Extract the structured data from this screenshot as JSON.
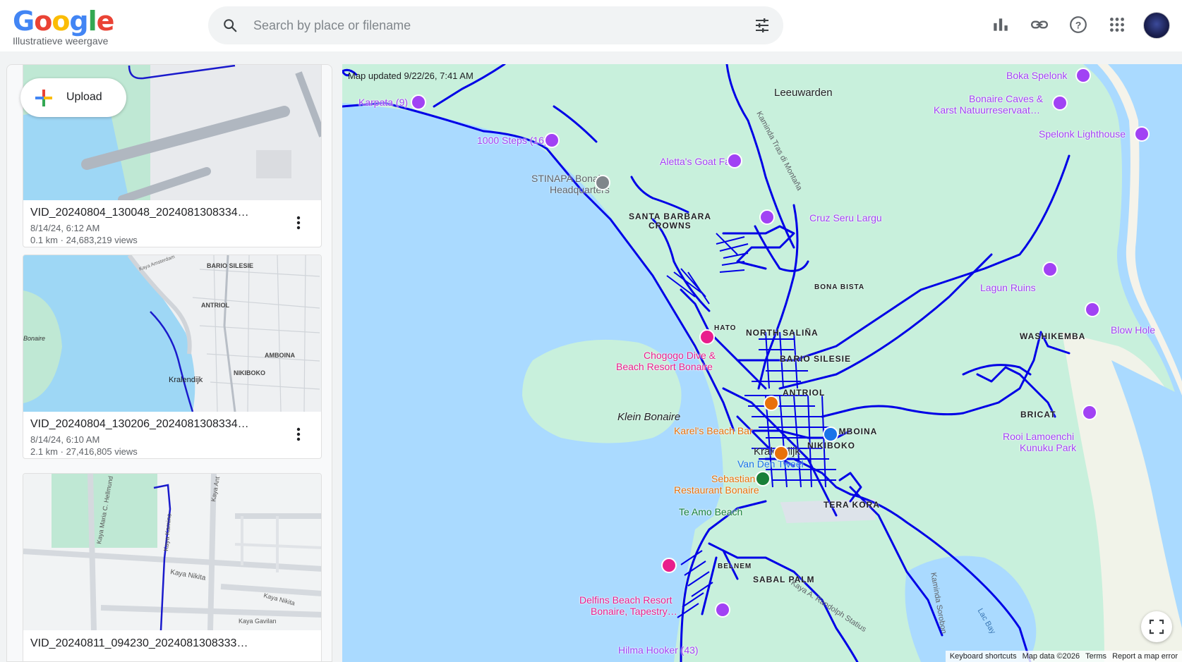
{
  "header": {
    "logo_letters": [
      "G",
      "o",
      "o",
      "g",
      "l",
      "e"
    ],
    "logo_colors": [
      "#4285F4",
      "#EA4335",
      "#FBBC05",
      "#4285F4",
      "#34A853",
      "#EA4335"
    ],
    "subtitle": "Illustratieve weergave",
    "search_placeholder": "Search by place or filename",
    "icons": [
      "bar-chart-icon",
      "link-icon",
      "help-icon",
      "apps-grid-icon"
    ]
  },
  "panel": {
    "upload_label": "Upload",
    "cards": [
      {
        "title": "VID_20240804_130048_2024081308334…",
        "date": "8/14/24, 6:12 AM",
        "stats": "0.1 km · 24,683,219 views"
      },
      {
        "title": "VID_20240804_130206_2024081308334…",
        "date": "8/14/24, 6:10 AM",
        "stats": "2.1 km · 27,416,805 views"
      },
      {
        "title": "VID_20240811_094230_2024081308333…",
        "date": "",
        "stats": ""
      }
    ],
    "thumb2_labels": {
      "bario": "BARIO SILESIE",
      "antriol": "ANTRIOL",
      "amboina": "AMBOINA",
      "nikiboko": "NIKIBOKO",
      "kralendijk": "Kralendijk",
      "bonaire": "Bonaire",
      "road1": "Kaya Amsterdam"
    },
    "thumb3_labels": {
      "r1": "Kaya Maria C. Hellmund",
      "r2": "Kaya Kamino",
      "r3": "Kaya Ant",
      "r4": "Kaya Nikita",
      "r5": "Kaya Nikita",
      "r6": "Kaya Gavilan"
    }
  },
  "map": {
    "updated": "Map updated 9/22/26, 7:41 AM",
    "labels": {
      "leeuwarden": "Leeuwarden",
      "boka_spelonk": "Boka Spelonk",
      "bonaire_caves_1": "Bonaire Caves &",
      "bonaire_caves_2": "Karst Natuurreservaat…",
      "spelonk_lighthouse": "Spelonk Lighthouse",
      "karpata": "Karpata (9)",
      "steps": "1000 Steps (16)",
      "aletta": "Aletta's Goat Farm",
      "stinapa_1": "STINAPA Bonaire",
      "stinapa_2": "Headquarters",
      "santa_barbara_1": "SANTA BARBARA",
      "santa_barbara_2": "CROWNS",
      "cruz": "Cruz Seru Largu",
      "bona_bista": "BONA BISTA",
      "lagun": "Lagun Ruins",
      "hato": "HATO",
      "north_salina": "NORTH SALIÑA",
      "washikemba": "WASHIKEMBA",
      "blow_hole": "Blow Hole",
      "chogogo_1": "Chogogo Dive &",
      "chogogo_2": "Beach Resort Bonaire",
      "bario_silesie": "BARIO SILESIE",
      "antriol": "ANTRIOL",
      "bricat": "BRICAT",
      "klein_bonaire": "Klein Bonaire",
      "karels": "Karel's Beach Bar",
      "amboina": "AMBOINA",
      "rooi_1": "Rooi Lamoenchi",
      "rooi_2": "Kunuku Park",
      "kralendijk": "Kralendijk",
      "nikiboko": "NIKIBOKO",
      "van_den_tweel": "Van Den Tweel",
      "sebastian_1": "Sebastian's",
      "sebastian_2": "Restaurant Bonaire",
      "tera_kora": "TERA KORA",
      "te_amo": "Te Amo Beach",
      "belnem": "BELNEM",
      "sabal_palm": "SABAL PALM",
      "delfins_1": "Delfins Beach Resort",
      "delfins_2": "Bonaire, Tapestry…",
      "hilma": "Hilma Hooker (43)",
      "road_kaminda": "Kaminda Tras di Montaña",
      "road_randolph": "Kaya A. Randolph Statius",
      "road_kaminda2": "Kaminda Sorobon",
      "lac_bay": "Lac Bay"
    },
    "footer": [
      "Keyboard shortcuts",
      "Map data ©2026",
      "Terms",
      "Report a map error"
    ],
    "colors": {
      "water": "#aadaff",
      "land": "#c8f0dc",
      "route": "#0000e6",
      "poi": "#a142f4"
    }
  }
}
